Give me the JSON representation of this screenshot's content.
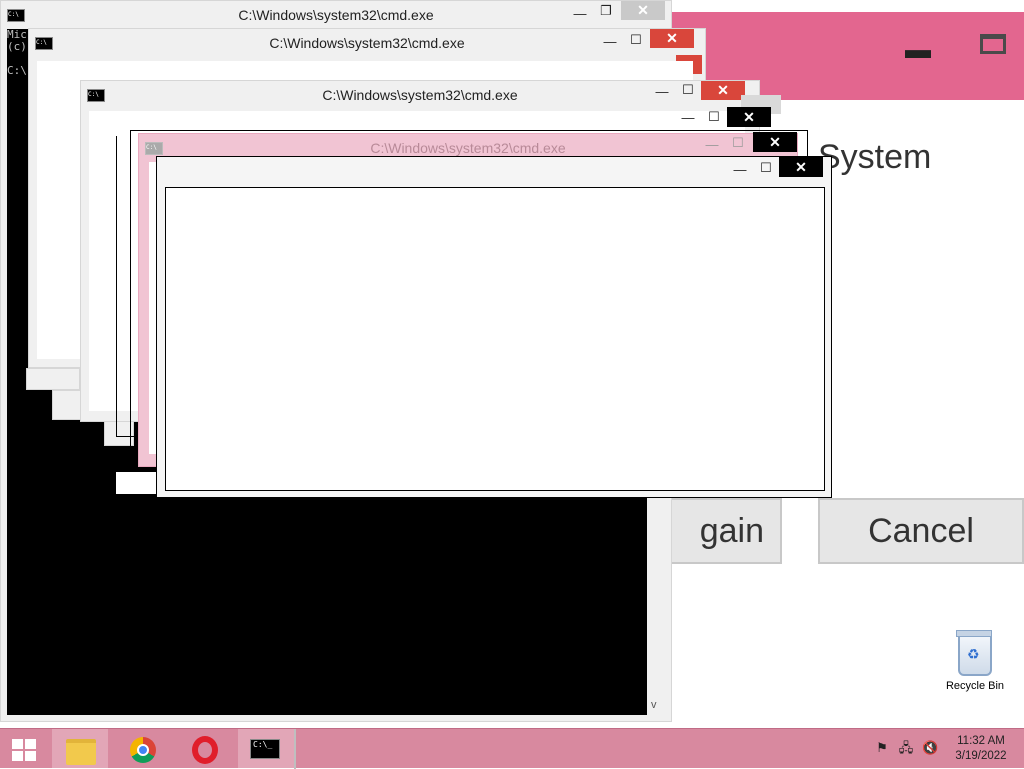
{
  "background_dialog": {
    "partial_title": "System",
    "buttons": {
      "try_again": "gain",
      "cancel": "Cancel"
    },
    "minimize_glyph": "▬",
    "accent_color": "#e3668f"
  },
  "desktop": {
    "recycle_bin_label": "Recycle Bin"
  },
  "cmd_windows": {
    "title": "C:\\Windows\\system32\\cmd.exe",
    "console_lines": "Mic\n(c)\n\nC:\\",
    "icon_label": "C:\\",
    "minimize_glyph": "—",
    "maximize_glyph": "☐",
    "restore_glyph": "❐",
    "close_glyph": "✕",
    "scroll_down_glyph": "v"
  },
  "taskbar": {
    "clock_time": "11:32 AM",
    "clock_date": "3/19/2022",
    "cmd_icon_label": "C:\\_",
    "tray_icons": [
      "flag-icon",
      "network-icon",
      "volume-muted-icon"
    ],
    "color": "#d8899f"
  }
}
